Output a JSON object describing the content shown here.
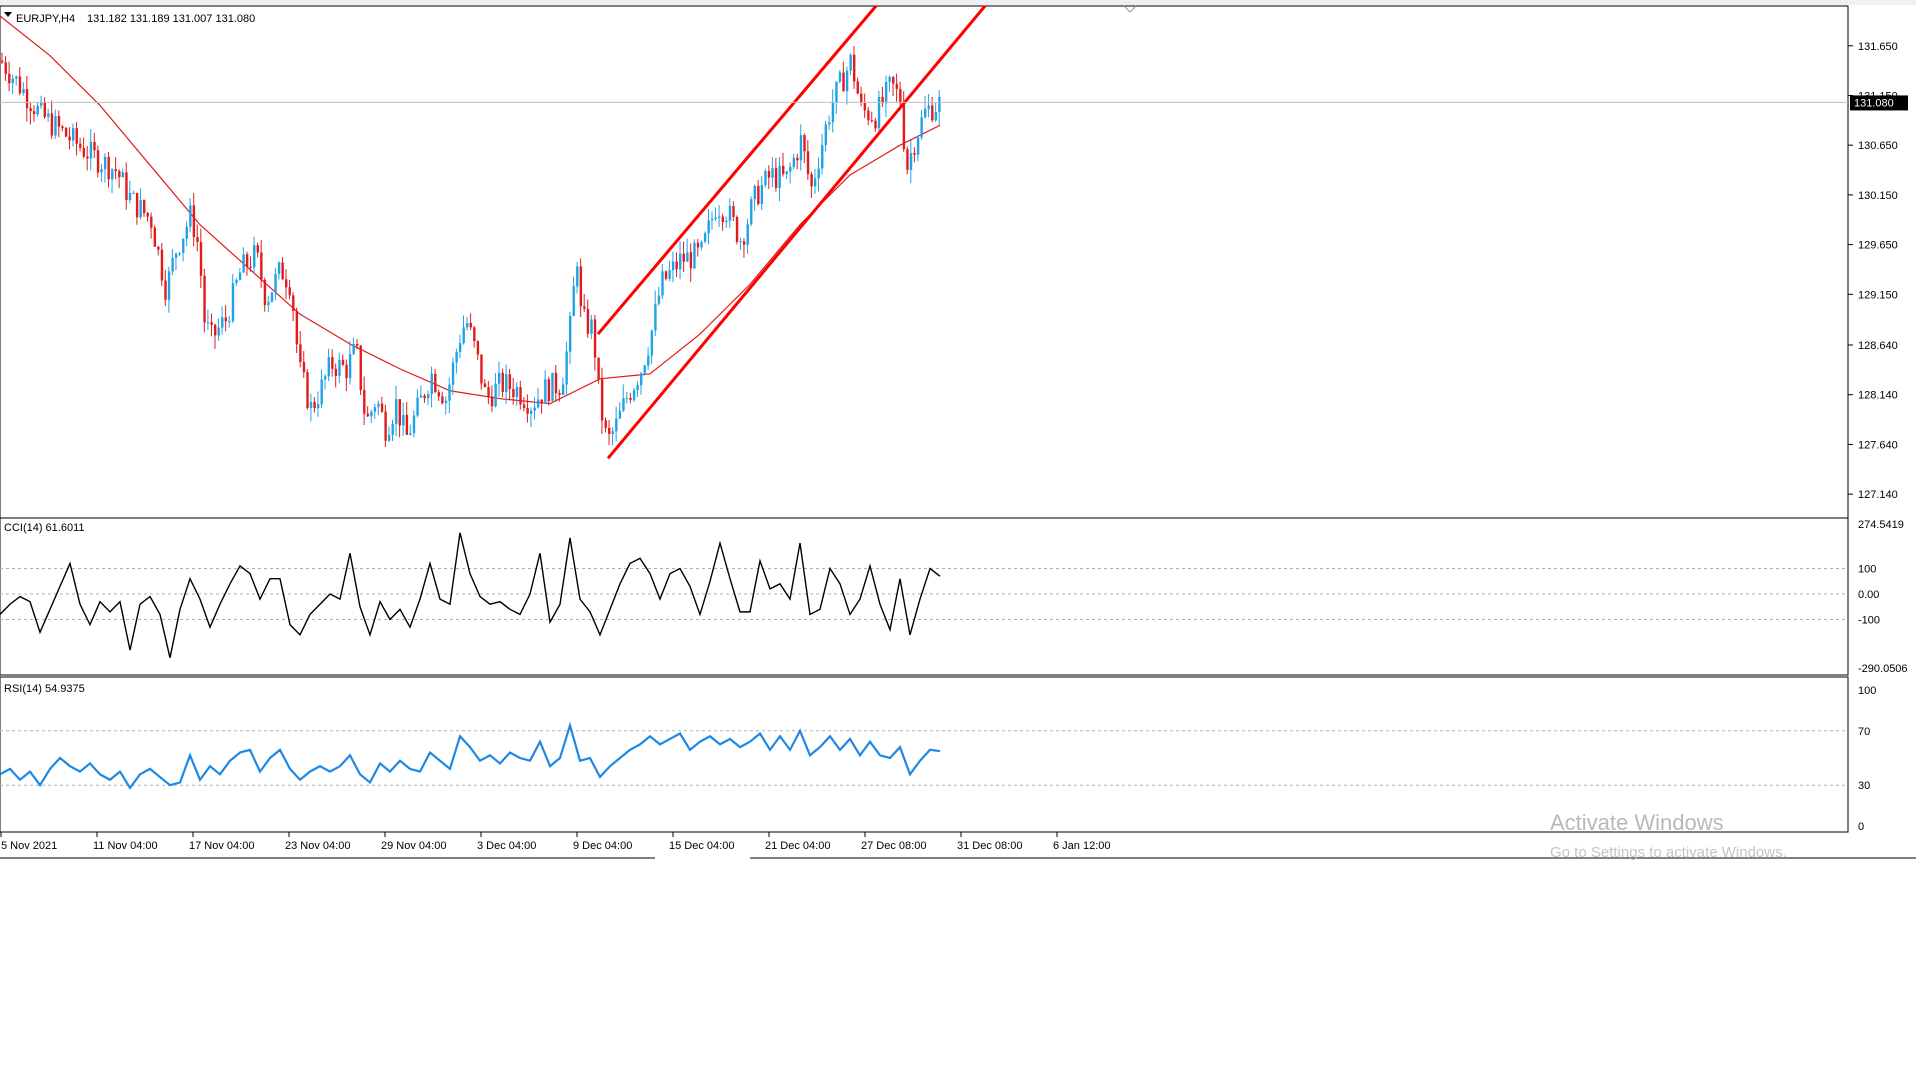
{
  "header": {
    "symbol": "EURJPY,H4",
    "ohlc": "131.182 131.189 131.007 131.080"
  },
  "colors": {
    "bull": "#1ea3e6",
    "bear": "#e01b1b",
    "ma": "#e01b1b",
    "channel": "#ff0000",
    "cci": "#000000",
    "rsi": "#1e88e5",
    "current_price_bg": "#000000",
    "grid": "#b0b0b0"
  },
  "main_axis": {
    "ticks": [
      "131.650",
      "131.150",
      "130.650",
      "130.150",
      "129.650",
      "129.150",
      "128.640",
      "128.140",
      "127.640",
      "127.140"
    ],
    "current_price": "131.080"
  },
  "cci_panel": {
    "label": "CCI(14) 61.6011",
    "ticks": [
      "274.5419",
      "100",
      "0.00",
      "-100",
      "-290.0506"
    ]
  },
  "rsi_panel": {
    "label": "RSI(14) 54.9375",
    "ticks": [
      "100",
      "70",
      "30",
      "0"
    ]
  },
  "time_axis": [
    "5 Nov 2021",
    "11 Nov 04:00",
    "17 Nov 04:00",
    "23 Nov 04:00",
    "29 Nov 04:00",
    "3 Dec 04:00",
    "9 Dec 04:00",
    "15 Dec 04:00",
    "21 Dec 04:00",
    "27 Dec 08:00",
    "31 Dec 08:00",
    "6 Jan 12:00"
  ],
  "watermark": {
    "title": "Activate Windows",
    "subtitle": "Go to Settings to activate Windows."
  },
  "chart_data": [
    {
      "type": "candlestick",
      "title": "EURJPY,H4",
      "ylim": [
        126.9,
        132.05
      ],
      "price_path": [
        [
          0,
          131.5
        ],
        [
          15,
          131.3
        ],
        [
          40,
          130.95
        ],
        [
          65,
          130.75
        ],
        [
          90,
          130.55
        ],
        [
          115,
          130.4
        ],
        [
          130,
          130.1
        ],
        [
          150,
          129.9
        ],
        [
          165,
          129.2
        ],
        [
          175,
          129.6
        ],
        [
          190,
          129.95
        ],
        [
          198,
          129.6
        ],
        [
          203,
          128.9
        ],
        [
          210,
          128.7
        ],
        [
          225,
          128.9
        ],
        [
          240,
          129.4
        ],
        [
          255,
          129.55
        ],
        [
          265,
          129.1
        ],
        [
          280,
          129.4
        ],
        [
          290,
          129.25
        ],
        [
          298,
          128.4
        ],
        [
          310,
          128.0
        ],
        [
          320,
          128.2
        ],
        [
          330,
          128.45
        ],
        [
          345,
          128.4
        ],
        [
          355,
          128.6
        ],
        [
          365,
          127.85
        ],
        [
          375,
          128.1
        ],
        [
          385,
          127.8
        ],
        [
          395,
          128.05
        ],
        [
          405,
          127.7
        ],
        [
          415,
          127.95
        ],
        [
          430,
          128.35
        ],
        [
          445,
          128.1
        ],
        [
          458,
          128.7
        ],
        [
          465,
          128.9
        ],
        [
          475,
          128.55
        ],
        [
          485,
          128.1
        ],
        [
          500,
          128.25
        ],
        [
          515,
          128.2
        ],
        [
          530,
          128.05
        ],
        [
          545,
          128.2
        ],
        [
          560,
          128.25
        ],
        [
          568,
          128.7
        ],
        [
          576,
          129.55
        ],
        [
          580,
          128.9
        ],
        [
          592,
          128.8
        ],
        [
          598,
          128.1
        ],
        [
          606,
          127.65
        ],
        [
          614,
          127.8
        ],
        [
          625,
          128.1
        ],
        [
          640,
          128.4
        ],
        [
          650,
          128.75
        ],
        [
          660,
          129.25
        ],
        [
          680,
          129.5
        ],
        [
          700,
          129.55
        ],
        [
          715,
          130.05
        ],
        [
          725,
          130.0
        ],
        [
          740,
          129.7
        ],
        [
          755,
          130.15
        ],
        [
          770,
          130.35
        ],
        [
          785,
          130.3
        ],
        [
          800,
          130.7
        ],
        [
          810,
          130.2
        ],
        [
          818,
          130.55
        ],
        [
          830,
          131.05
        ],
        [
          850,
          131.5
        ],
        [
          860,
          131.0
        ],
        [
          875,
          130.95
        ],
        [
          890,
          131.25
        ],
        [
          900,
          131.1
        ],
        [
          905,
          130.4
        ],
        [
          915,
          130.75
        ],
        [
          925,
          131.0
        ],
        [
          940,
          131.08
        ]
      ],
      "moving_average": [
        [
          0,
          131.95
        ],
        [
          50,
          131.55
        ],
        [
          100,
          131.05
        ],
        [
          150,
          130.45
        ],
        [
          200,
          129.85
        ],
        [
          250,
          129.4
        ],
        [
          300,
          128.95
        ],
        [
          350,
          128.65
        ],
        [
          400,
          128.4
        ],
        [
          450,
          128.18
        ],
        [
          500,
          128.1
        ],
        [
          550,
          128.05
        ],
        [
          600,
          128.3
        ],
        [
          650,
          128.35
        ],
        [
          700,
          128.75
        ],
        [
          750,
          129.25
        ],
        [
          800,
          129.85
        ],
        [
          850,
          130.35
        ],
        [
          900,
          130.65
        ],
        [
          940,
          130.85
        ]
      ],
      "channel_lines": [
        {
          "from": [
            598,
            128.75
          ],
          "to": [
            876,
            132.05
          ]
        },
        {
          "from": [
            608,
            127.5
          ],
          "to": [
            985,
            132.05
          ]
        }
      ]
    },
    {
      "type": "line",
      "title": "CCI(14) 61.6011",
      "ylim": [
        -290.0506,
        274.5419
      ],
      "x": [
        0,
        10,
        20,
        30,
        40,
        50,
        60,
        70,
        80,
        90,
        100,
        110,
        120,
        130,
        140,
        150,
        160,
        170,
        180,
        190,
        200,
        210,
        220,
        230,
        240,
        250,
        260,
        270,
        280,
        290,
        300,
        310,
        320,
        330,
        340,
        350,
        360,
        370,
        380,
        390,
        400,
        410,
        420,
        430,
        440,
        450,
        460,
        470,
        480,
        490,
        500,
        510,
        520,
        530,
        540,
        550,
        560,
        570,
        580,
        590,
        600,
        610,
        620,
        630,
        640,
        650,
        660,
        670,
        680,
        690,
        700,
        710,
        720,
        730,
        740,
        750,
        760,
        770,
        780,
        790,
        800,
        810,
        820,
        830,
        840,
        850,
        860,
        870,
        880,
        890,
        900,
        910,
        920,
        930,
        940
      ],
      "values": [
        -80,
        -40,
        -10,
        -30,
        -150,
        -60,
        30,
        120,
        -40,
        -120,
        -30,
        -70,
        -30,
        -220,
        -40,
        -10,
        -80,
        -250,
        -60,
        60,
        -20,
        -130,
        -40,
        40,
        110,
        80,
        -20,
        60,
        60,
        -120,
        -160,
        -80,
        -40,
        0,
        -20,
        160,
        -50,
        -160,
        -30,
        -100,
        -60,
        -130,
        -20,
        120,
        -20,
        -40,
        240,
        80,
        -10,
        -40,
        -30,
        -60,
        -80,
        0,
        160,
        -110,
        -40,
        220,
        -20,
        -70,
        -160,
        -60,
        40,
        120,
        140,
        80,
        -20,
        80,
        100,
        30,
        -80,
        50,
        200,
        60,
        -70,
        -70,
        130,
        20,
        40,
        -20,
        200,
        -80,
        -60,
        100,
        40,
        -80,
        -20,
        110,
        -40,
        -140,
        60,
        -160,
        -20,
        100,
        70
      ]
    },
    {
      "type": "line",
      "title": "RSI(14) 54.9375",
      "ylim": [
        0,
        100
      ],
      "x": [
        0,
        10,
        20,
        30,
        40,
        50,
        60,
        70,
        80,
        90,
        100,
        110,
        120,
        130,
        140,
        150,
        160,
        170,
        180,
        190,
        200,
        210,
        220,
        230,
        240,
        250,
        260,
        270,
        280,
        290,
        300,
        310,
        320,
        330,
        340,
        350,
        360,
        370,
        380,
        390,
        400,
        410,
        420,
        430,
        440,
        450,
        460,
        470,
        480,
        490,
        500,
        510,
        520,
        530,
        540,
        550,
        560,
        570,
        580,
        590,
        600,
        610,
        620,
        630,
        640,
        650,
        660,
        670,
        680,
        690,
        700,
        710,
        720,
        730,
        740,
        750,
        760,
        770,
        780,
        790,
        800,
        810,
        820,
        830,
        840,
        850,
        860,
        870,
        880,
        890,
        900,
        910,
        920,
        930,
        940
      ],
      "values": [
        38,
        42,
        34,
        40,
        30,
        42,
        50,
        44,
        40,
        46,
        38,
        34,
        40,
        28,
        38,
        42,
        36,
        30,
        32,
        52,
        34,
        44,
        38,
        48,
        54,
        56,
        40,
        50,
        56,
        42,
        34,
        40,
        44,
        40,
        44,
        52,
        38,
        32,
        46,
        40,
        48,
        42,
        40,
        54,
        48,
        42,
        66,
        58,
        48,
        52,
        46,
        54,
        50,
        48,
        62,
        44,
        50,
        74,
        48,
        50,
        36,
        44,
        50,
        56,
        60,
        66,
        60,
        64,
        68,
        56,
        62,
        66,
        60,
        64,
        58,
        62,
        68,
        56,
        66,
        56,
        70,
        52,
        58,
        66,
        56,
        64,
        52,
        62,
        52,
        50,
        58,
        38,
        48,
        56,
        55
      ]
    }
  ]
}
